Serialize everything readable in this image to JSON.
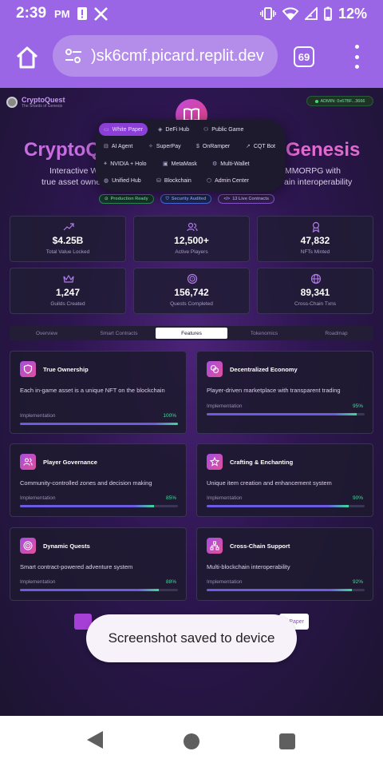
{
  "status": {
    "time": "2:39",
    "ampm": "PM",
    "battery": "12%"
  },
  "browser": {
    "url": ")sk6cmf.picard.replit.dev",
    "tab_count": "69"
  },
  "app": {
    "brand_name": "CryptoQuest",
    "brand_sub": "The Shards of Genesis",
    "admin": "ADMIN: 0x67BF...3666",
    "hero_title_left": "CryptoQ",
    "hero_title_right": "Genesis",
    "hero_sub_left_1": "Interactive W",
    "hero_sub_left_2": "true asset owners",
    "hero_sub_right_1": "MMORPG with",
    "hero_sub_right_2": "ain interoperability",
    "badges": [
      "Production Ready",
      "Security Audited",
      "13 Live Contracts"
    ]
  },
  "menu": {
    "items": [
      {
        "label": "White Paper",
        "icon": "book-icon"
      },
      {
        "label": "DeFi Hub",
        "icon": "layers-icon"
      },
      {
        "label": "Public Game",
        "icon": "users-icon"
      },
      {
        "label": "AI Agent",
        "icon": "bot-icon"
      },
      {
        "label": "SuperPay",
        "icon": "sparkle-icon"
      },
      {
        "label": "OnRamper",
        "icon": "dollar-icon"
      },
      {
        "label": "CQT Bot",
        "icon": "trend-icon"
      },
      {
        "label": "NVIDIA + Holo",
        "icon": "wand-icon"
      },
      {
        "label": "MetaMask",
        "icon": "wallet-icon"
      },
      {
        "label": "Multi-Wallet",
        "icon": "gear-icon"
      },
      {
        "label": "Unified Hub",
        "icon": "globe-icon"
      },
      {
        "label": "Blockchain",
        "icon": "database-icon"
      },
      {
        "label": "Admin Center",
        "icon": "shield-icon"
      }
    ]
  },
  "stats": [
    {
      "value": "$4.25B",
      "label": "Total Value Locked",
      "icon": "trend-up-icon"
    },
    {
      "value": "12,500+",
      "label": "Active Players",
      "icon": "users-icon"
    },
    {
      "value": "47,832",
      "label": "NFTs Minted",
      "icon": "award-icon"
    },
    {
      "value": "1,247",
      "label": "Guilds Created",
      "icon": "crown-icon"
    },
    {
      "value": "156,742",
      "label": "Quests Completed",
      "icon": "target-icon"
    },
    {
      "value": "89,341",
      "label": "Cross-Chain Txns",
      "icon": "globe-icon"
    }
  ],
  "tabs": [
    "Overview",
    "Smart Contracts",
    "Features",
    "Tokenomics",
    "Roadmap"
  ],
  "features": [
    {
      "title": "True Ownership",
      "desc": "Each in-game asset is a unique NFT on the blockchain",
      "impl_label": "Implementation",
      "pct_label": "100%",
      "pct": 100,
      "icon": "shield-icon"
    },
    {
      "title": "Decentralized Economy",
      "desc": "Player-driven marketplace with transparent trading",
      "impl_label": "Implementation",
      "pct_label": "95%",
      "pct": 95,
      "icon": "coins-icon"
    },
    {
      "title": "Player Governance",
      "desc": "Community-controlled zones and decision making",
      "impl_label": "Implementation",
      "pct_label": "85%",
      "pct": 85,
      "icon": "users-icon"
    },
    {
      "title": "Crafting & Enchanting",
      "desc": "Unique item creation and enhancement system",
      "impl_label": "Implementation",
      "pct_label": "90%",
      "pct": 90,
      "icon": "star-icon"
    },
    {
      "title": "Dynamic Quests",
      "desc": "Smart contract-powered adventure system",
      "impl_label": "Implementation",
      "pct_label": "88%",
      "pct": 88,
      "icon": "target-icon"
    },
    {
      "title": "Cross-Chain Support",
      "desc": "Multi-blockchain interoperability",
      "impl_label": "Implementation",
      "pct_label": "92%",
      "pct": 92,
      "icon": "network-icon"
    }
  ],
  "partial_button_text": "Paper",
  "toast": "Screenshot saved to device",
  "colors": {
    "browser_chrome": "#9a66e6",
    "accent": "#8b3fd6",
    "progress": "#6a5be0",
    "success": "#3fd89a"
  }
}
